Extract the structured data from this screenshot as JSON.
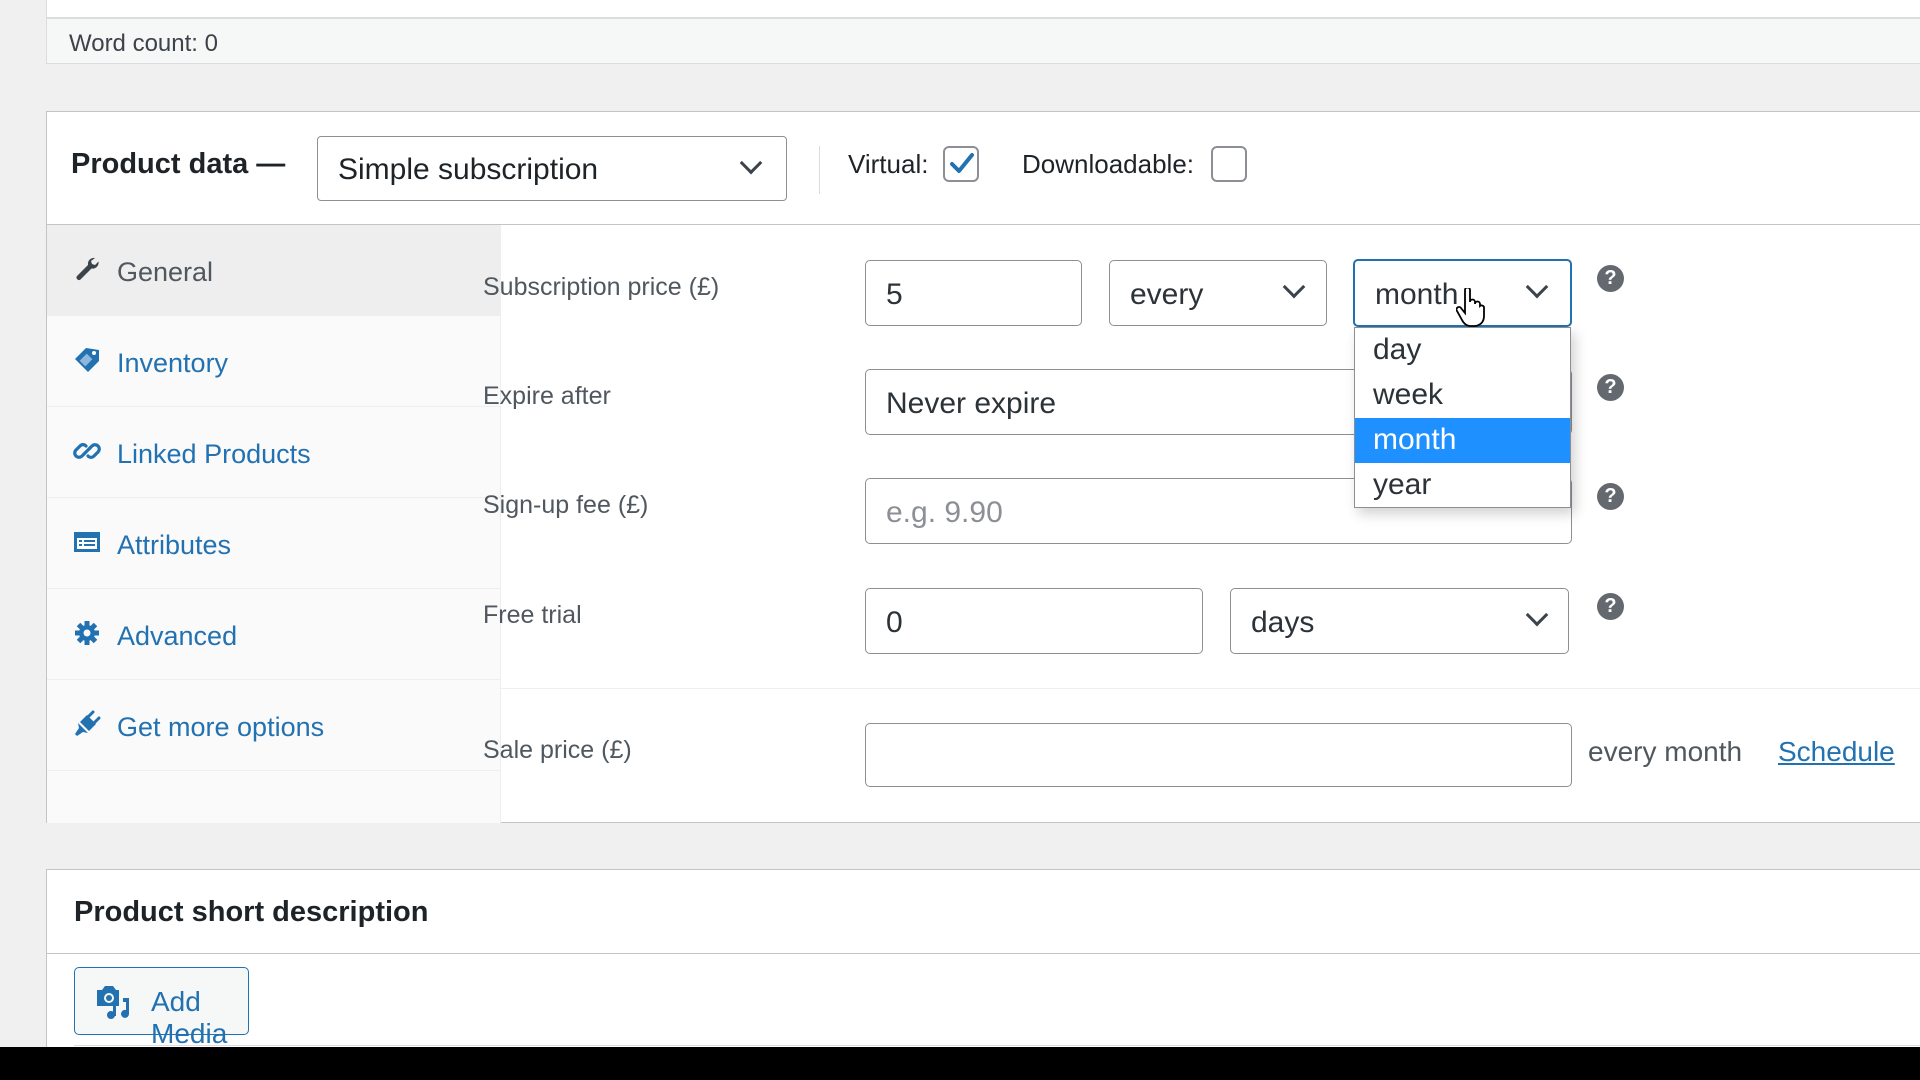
{
  "editor": {
    "word_count": "Word count: 0"
  },
  "product_data": {
    "title": "Product data —",
    "product_type": "Simple subscription",
    "virtual_label": "Virtual:",
    "virtual_checked": true,
    "downloadable_label": "Downloadable:",
    "downloadable_checked": false
  },
  "tabs": [
    {
      "label": "General",
      "icon": "wrench-icon",
      "active": true
    },
    {
      "label": "Inventory",
      "icon": "tag-icon",
      "active": false
    },
    {
      "label": "Linked Products",
      "icon": "link-icon",
      "active": false
    },
    {
      "label": "Attributes",
      "icon": "attributes-card-icon",
      "active": false
    },
    {
      "label": "Advanced",
      "icon": "gear-icon",
      "active": false
    },
    {
      "label": "Get more options",
      "icon": "plug-icon",
      "active": false
    }
  ],
  "fields": {
    "subscription_price": {
      "label": "Subscription price (£)",
      "value": "5",
      "interval": "every",
      "period": "month",
      "period_options": [
        "day",
        "week",
        "month",
        "year"
      ],
      "period_highlighted": "month"
    },
    "expire_after": {
      "label": "Expire after",
      "value": "Never expire"
    },
    "signup_fee": {
      "label": "Sign-up fee (£)",
      "placeholder": "e.g. 9.90",
      "value": ""
    },
    "free_trial": {
      "label": "Free trial",
      "value": "0",
      "unit": "days"
    },
    "sale_price": {
      "label": "Sale price (£)",
      "value": "",
      "suffix": "every month",
      "schedule_link": "Schedule"
    }
  },
  "short_description": {
    "title": "Product short description",
    "add_media_label": "Add Media"
  },
  "colors": {
    "accent": "#2271b1",
    "highlight": "#1e90ff",
    "help_icon": "#646970"
  }
}
